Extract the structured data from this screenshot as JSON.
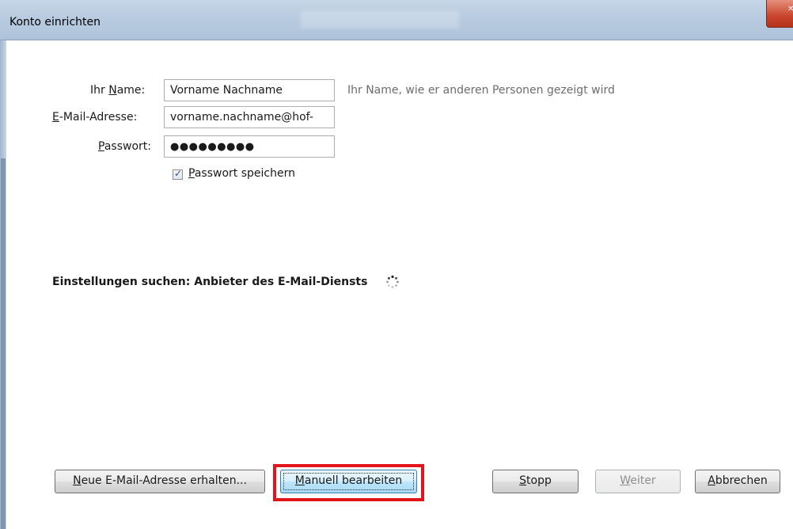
{
  "window": {
    "title": "Konto einrichten"
  },
  "form": {
    "name_label_pre": "Ihr ",
    "name_label_key": "N",
    "name_label_post": "ame:",
    "name_value": "Vorname Nachname",
    "name_hint": "Ihr Name, wie er anderen Personen gezeigt wird",
    "email_label_key": "E",
    "email_label_post": "-Mail-Adresse:",
    "email_value": "vorname.nachname@hof-",
    "password_label_key": "P",
    "password_label_post": "asswort:",
    "password_value": "●●●●●●●●●",
    "remember_password_key": "P",
    "remember_password_post": "asswort speichern",
    "remember_password_checked": true
  },
  "status": {
    "text": "Einstellungen suchen: Anbieter des E-Mail-Diensts"
  },
  "buttons": {
    "new_email_key": "N",
    "new_email_post": "eue E-Mail-Adresse erhalten...",
    "manual_key": "M",
    "manual_post": "anuell bearbeiten",
    "stop_key": "S",
    "stop_post": "topp",
    "next_key": "W",
    "next_post": "eiter",
    "cancel_key": "A",
    "cancel_post": "bbrechen"
  },
  "colors": {
    "highlight": "#e3151b",
    "hint_text": "#6d6d6d"
  },
  "icons": {
    "spinner": "loading-spinner-icon",
    "close": "close-icon",
    "checkmark": "checkmark-icon"
  }
}
